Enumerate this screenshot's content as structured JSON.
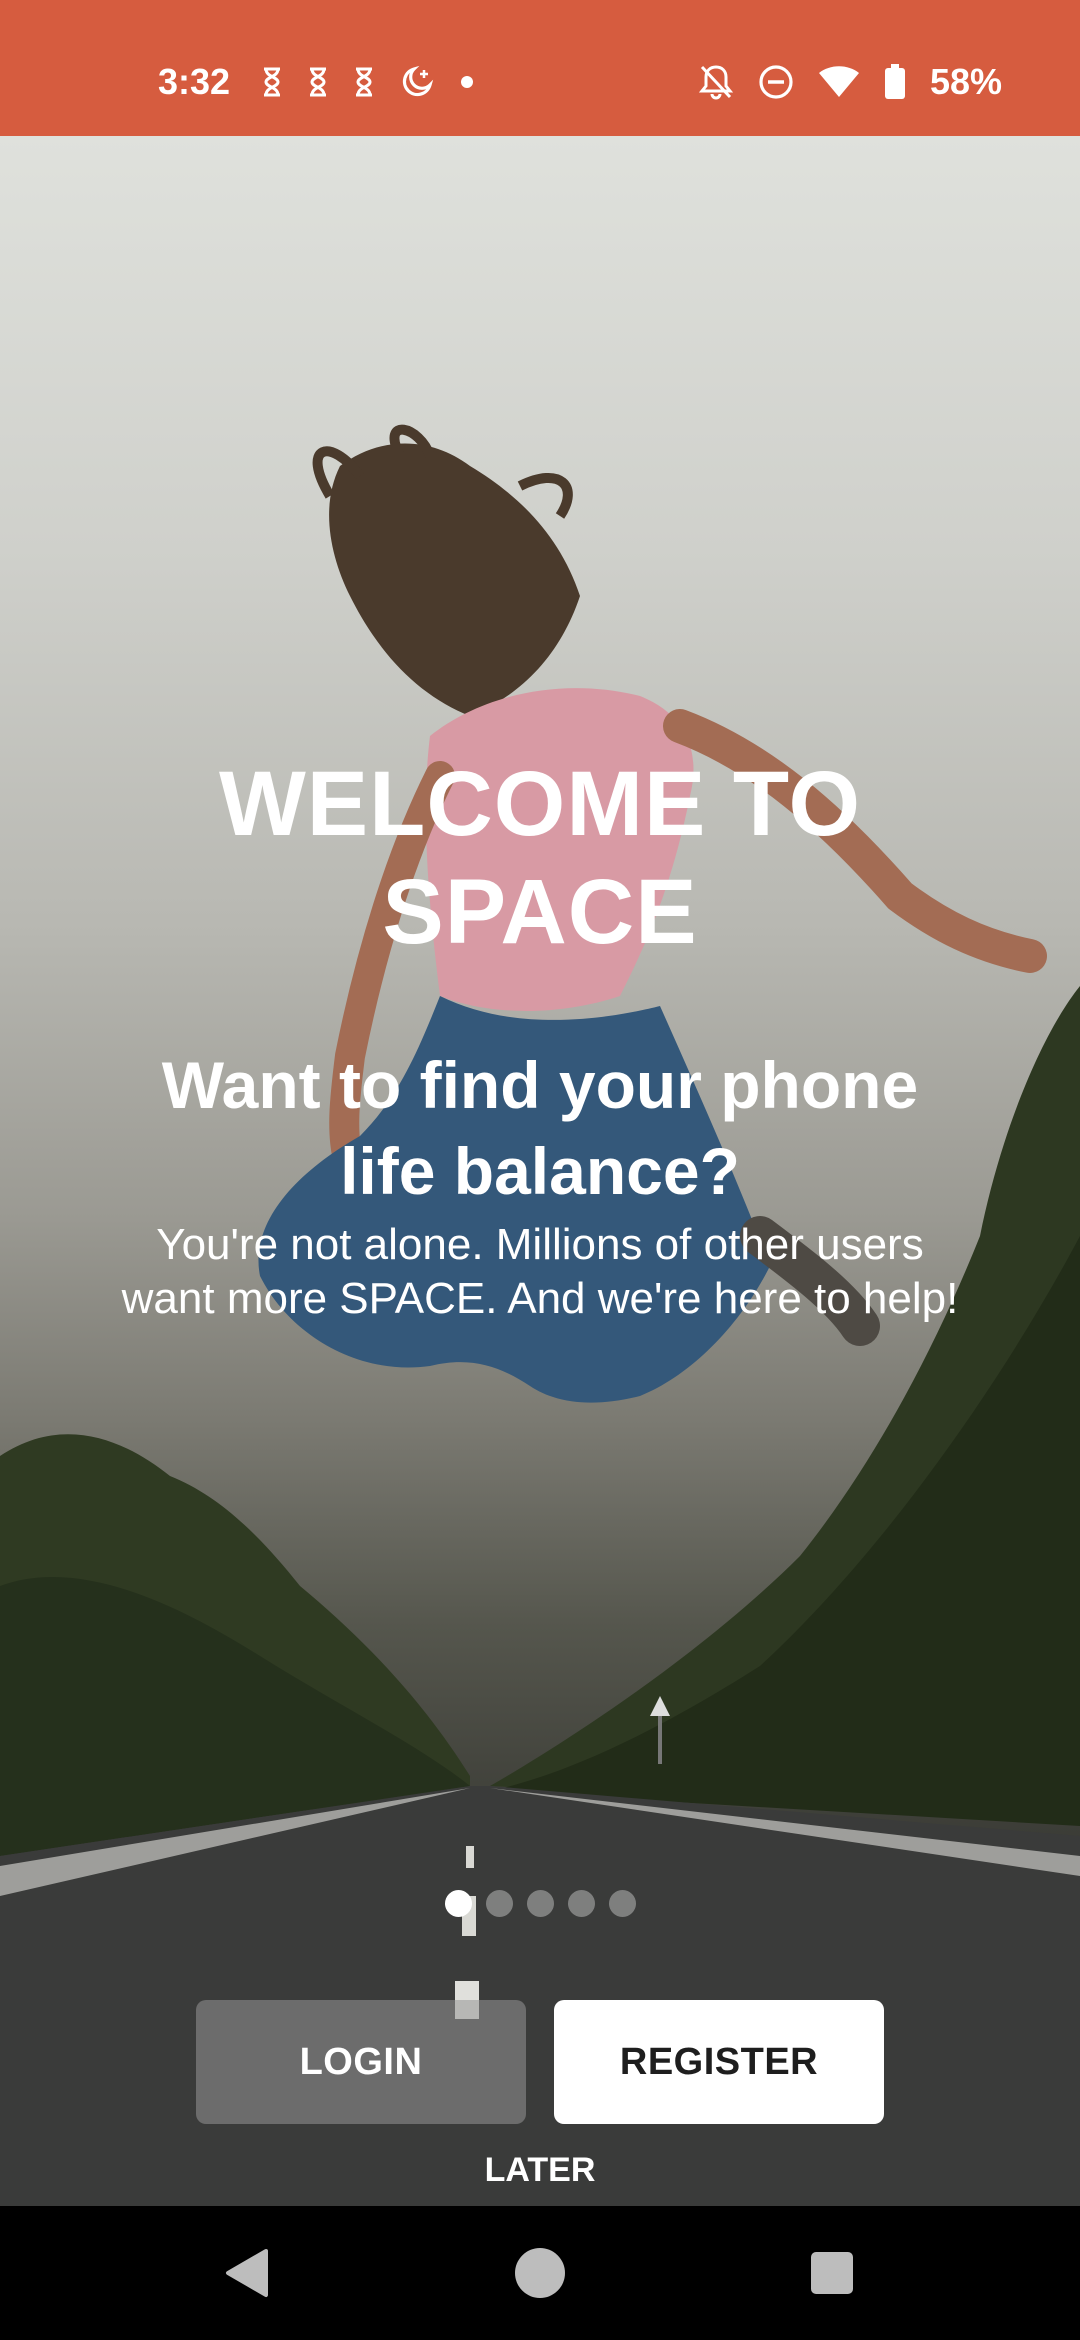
{
  "status_bar": {
    "time": "3:32",
    "battery": "58%",
    "color": "#d65c3f",
    "icons_left": [
      "hourglass-icon",
      "hourglass-icon",
      "hourglass-icon",
      "bedtime-icon",
      "notification-dot-icon"
    ],
    "icons_right": [
      "bell-off-icon",
      "do-not-disturb-icon",
      "wifi-icon",
      "battery-icon"
    ]
  },
  "welcome": {
    "title_line1": "WELCOME TO",
    "title_line2": "SPACE",
    "subtitle_line1": "Want to find your phone",
    "subtitle_line2": "life balance?",
    "body_line1": "You're not alone. Millions of other users",
    "body_line2": "want more SPACE. And we're here to help!"
  },
  "pager": {
    "total": 5,
    "active": 1
  },
  "actions": {
    "login_label": "LOGIN",
    "register_label": "REGISTER",
    "later_label": "LATER"
  },
  "nav_bar": {
    "icons": [
      "back-icon",
      "home-icon",
      "recents-icon"
    ]
  }
}
